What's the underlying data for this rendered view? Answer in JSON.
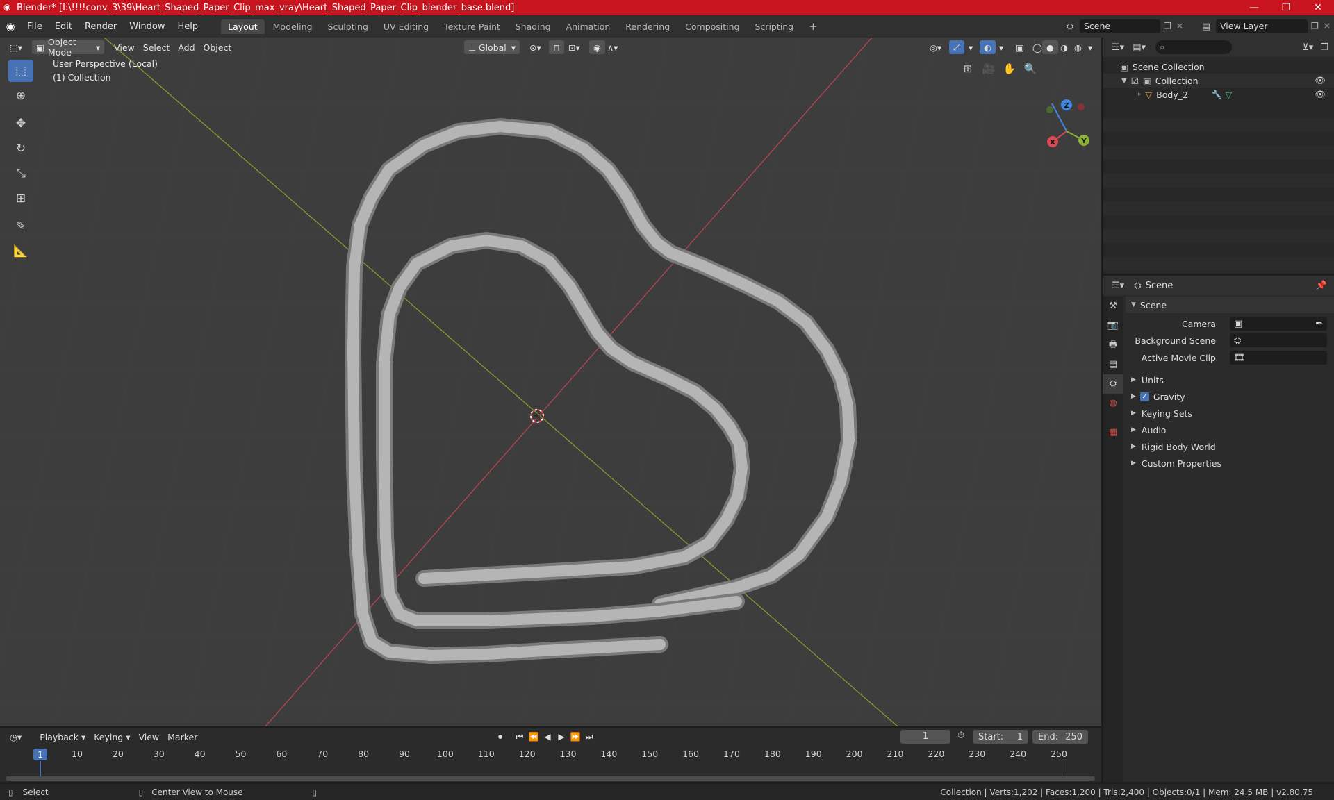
{
  "window": {
    "title": "Blender* [I:\\!!!!conv_3\\39\\Heart_Shaped_Paper_Clip_max_vray\\Heart_Shaped_Paper_Clip_blender_base.blend]",
    "minimize": "—",
    "maximize": "❐",
    "close": "✕"
  },
  "menu": [
    "File",
    "Edit",
    "Render",
    "Window",
    "Help"
  ],
  "workspaces": [
    "Layout",
    "Modeling",
    "Sculpting",
    "UV Editing",
    "Texture Paint",
    "Shading",
    "Animation",
    "Rendering",
    "Compositing",
    "Scripting"
  ],
  "active_workspace": "Layout",
  "add_workspace": "+",
  "scene_selector": "Scene",
  "view_layer_selector": "View Layer",
  "viewport": {
    "mode": "Object Mode",
    "menus": [
      "View",
      "Select",
      "Add",
      "Object"
    ],
    "transform_orientation": "Global",
    "info_line1": "User Perspective (Local)",
    "info_line2": "(1) Collection",
    "gizmo_x": "X",
    "gizmo_y": "Y",
    "gizmo_z": "Z"
  },
  "outliner": {
    "search_placeholder": "",
    "root": "Scene Collection",
    "collection": "Collection",
    "object": "Body_2"
  },
  "properties": {
    "context": "Scene",
    "panel": "Scene",
    "camera_label": "Camera",
    "background_scene_label": "Background Scene",
    "active_movie_clip_label": "Active Movie Clip",
    "sections": [
      "Units",
      "Gravity",
      "Keying Sets",
      "Audio",
      "Rigid Body World",
      "Custom Properties"
    ]
  },
  "timeline": {
    "menus": [
      "Playback",
      "Keying",
      "View",
      "Marker"
    ],
    "current_frame": "1",
    "start_label": "Start:",
    "start_value": "1",
    "end_label": "End:",
    "end_value": "250",
    "ticks": [
      "1",
      "10",
      "20",
      "30",
      "40",
      "50",
      "60",
      "70",
      "80",
      "90",
      "100",
      "110",
      "120",
      "130",
      "140",
      "150",
      "160",
      "170",
      "180",
      "190",
      "200",
      "210",
      "220",
      "230",
      "240",
      "250"
    ]
  },
  "statusbar": {
    "select": "Select",
    "center_view": "Center View to Mouse",
    "stats": "Collection | Verts:1,202 | Faces:1,200 | Tris:2,400 | Objects:0/1 | Mem: 24.5 MB | v2.80.75"
  },
  "colors": {
    "accent": "#4772b3",
    "titlebar": "#c8141e",
    "axis_x": "#d94a55",
    "axis_y": "#8ab234",
    "axis_z": "#3f86e0"
  }
}
